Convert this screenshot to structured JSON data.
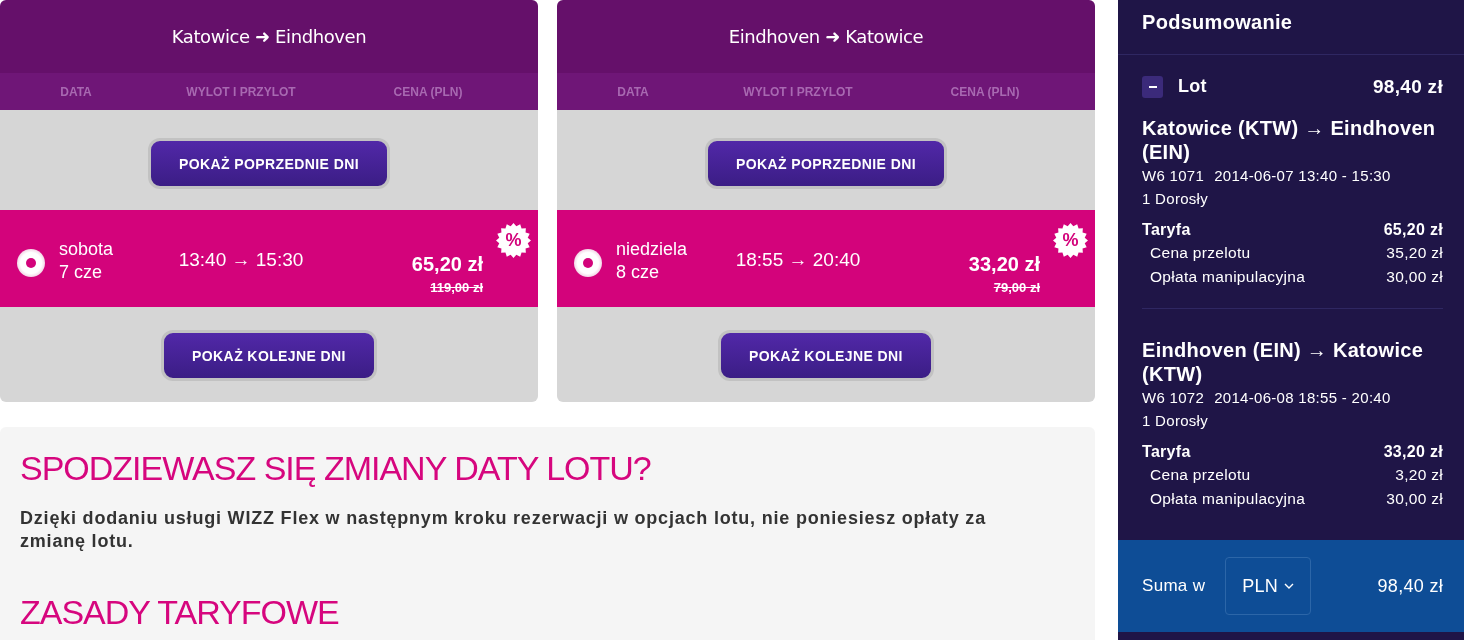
{
  "flights": [
    {
      "title": "Katowice ➜ Eindhoven",
      "columns": [
        "DATA",
        "WYLOT I PRZYLOT",
        "CENA (PLN)"
      ],
      "earlier_button": "POKAŻ POPRZEDNIE DNI",
      "later_button": "POKAŻ KOLEJNE DNI",
      "options": [
        {
          "selected": true,
          "day": "sobota",
          "date": "7 cze",
          "times": "13:40 → 15:30",
          "price": "65,20 zł",
          "old_price": "119,00 zł",
          "badge": "%"
        }
      ]
    },
    {
      "title": "Eindhoven ➜ Katowice",
      "columns": [
        "DATA",
        "WYLOT I PRZYLOT",
        "CENA (PLN)"
      ],
      "earlier_button": "POKAŻ POPRZEDNIE DNI",
      "later_button": "POKAŻ KOLEJNE DNI",
      "options": [
        {
          "selected": true,
          "day": "niedziela",
          "date": "8 cze",
          "times": "18:55 → 20:40",
          "price": "33,20 zł",
          "old_price": "79,00 zł",
          "badge": "%"
        }
      ]
    }
  ],
  "notices": [
    {
      "heading": "SPODZIEWASZ SIĘ ZMIANY DATY LOTU?",
      "text": "Dzięki dodaniu usługi WIZZ Flex w następnym kroku rezerwacji w opcjach lotu, nie poniesiesz opłaty za zmianę lotu."
    },
    {
      "heading": "ZASADY TARYFOWE"
    }
  ],
  "summary": {
    "title": "Podsumowanie",
    "section": {
      "expanded": true,
      "label": "Lot",
      "total": "98,40 zł"
    },
    "segments": [
      {
        "route": "Katowice (KTW) → Eindhoven (EIN)",
        "flight_number": "W6 1071",
        "schedule": "2014-06-07 13:40 - 15:30",
        "passengers": "1 Dorosły",
        "fare_label": "Taryfa",
        "fare_total": "65,20 zł",
        "items": [
          {
            "label": "Cena przelotu",
            "amount": "35,20 zł"
          },
          {
            "label": "Opłata manipulacyjna",
            "amount": "30,00 zł"
          }
        ]
      },
      {
        "route": "Eindhoven (EIN) → Katowice (KTW)",
        "flight_number": "W6 1072",
        "schedule": "2014-06-08 18:55 - 20:40",
        "passengers": "1 Dorosły",
        "fare_label": "Taryfa",
        "fare_total": "33,20 zł",
        "items": [
          {
            "label": "Cena przelotu",
            "amount": "3,20 zł"
          },
          {
            "label": "Opłata manipulacyjna",
            "amount": "30,00 zł"
          }
        ]
      }
    ],
    "footer": {
      "label": "Suma w",
      "currency": "PLN",
      "total": "98,40 zł"
    }
  }
}
